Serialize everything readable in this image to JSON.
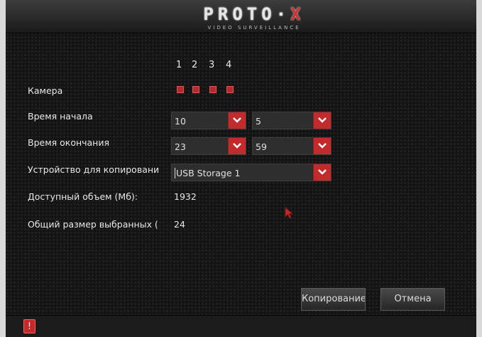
{
  "header": {
    "logo_main": "PROTO",
    "logo_x": "X",
    "logo_sub": "VIDEO SURVEILLANCE"
  },
  "form": {
    "channels": [
      "1",
      "2",
      "3",
      "4"
    ],
    "camera_label": "Камера",
    "start_time_label": "Время начала",
    "start_hour": "10",
    "start_minute": "5",
    "end_time_label": "Время окончания",
    "end_hour": "23",
    "end_minute": "59",
    "device_label": "Устройство для копировани",
    "device_value": "USB Storage 1",
    "available_label": "Доступный объем (Мб):",
    "available_value": "1932",
    "total_label": "Общий размер выбранных (",
    "total_value": "24"
  },
  "buttons": {
    "copy_label": "Копирование",
    "cancel_label": "Отмена"
  },
  "icons": {
    "dropdown": "chevron-down-icon",
    "info": "info-icon",
    "cursor": "mouse-pointer-icon"
  },
  "colors": {
    "accent": "#c22b2b",
    "background": "#141414",
    "text": "#e8e8e8"
  }
}
